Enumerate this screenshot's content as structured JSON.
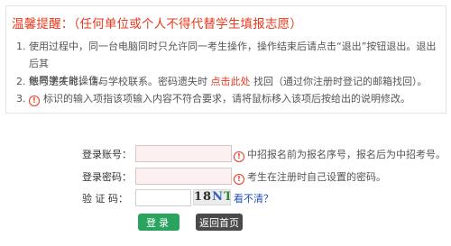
{
  "notice": {
    "title": "温馨提醒：（任何单位或个人不得代替学生填报志愿）",
    "items": [
      {
        "num": "1.",
        "line1": "使用过程中，同一台电脑同时只允许同一考生操作，操作结束后请点击“退出”按钮退出。退出后其",
        "line2": "他同学才能操作。"
      },
      {
        "num": "2.",
        "pre": "账号遗失时，请与学校联系。密码遗失时 ",
        "link": "点击此处",
        "post": " 找回（通过你注册时登记的邮箱找回）。"
      },
      {
        "num": "3.",
        "alert_symbol": "!",
        "text": "标识的输入项指该项输入内容不符合要求，请将鼠标移入该项后按给出的说明修改。"
      }
    ]
  },
  "form": {
    "account": {
      "label": "登录账号：",
      "value": "",
      "alert_symbol": "!",
      "hint": "中招报名前为报名序号，报名后为中招考号。"
    },
    "password": {
      "label": "登录密码：",
      "value": "",
      "alert_symbol": "!",
      "hint": "考生在注册时自己设置的密码。"
    },
    "captcha": {
      "label": "验 证 码：",
      "value": "",
      "image_chars": [
        "1",
        "8",
        "N",
        "T"
      ],
      "refresh_link": "看不清？"
    }
  },
  "buttons": {
    "login": "登录",
    "home": "返回首页"
  }
}
